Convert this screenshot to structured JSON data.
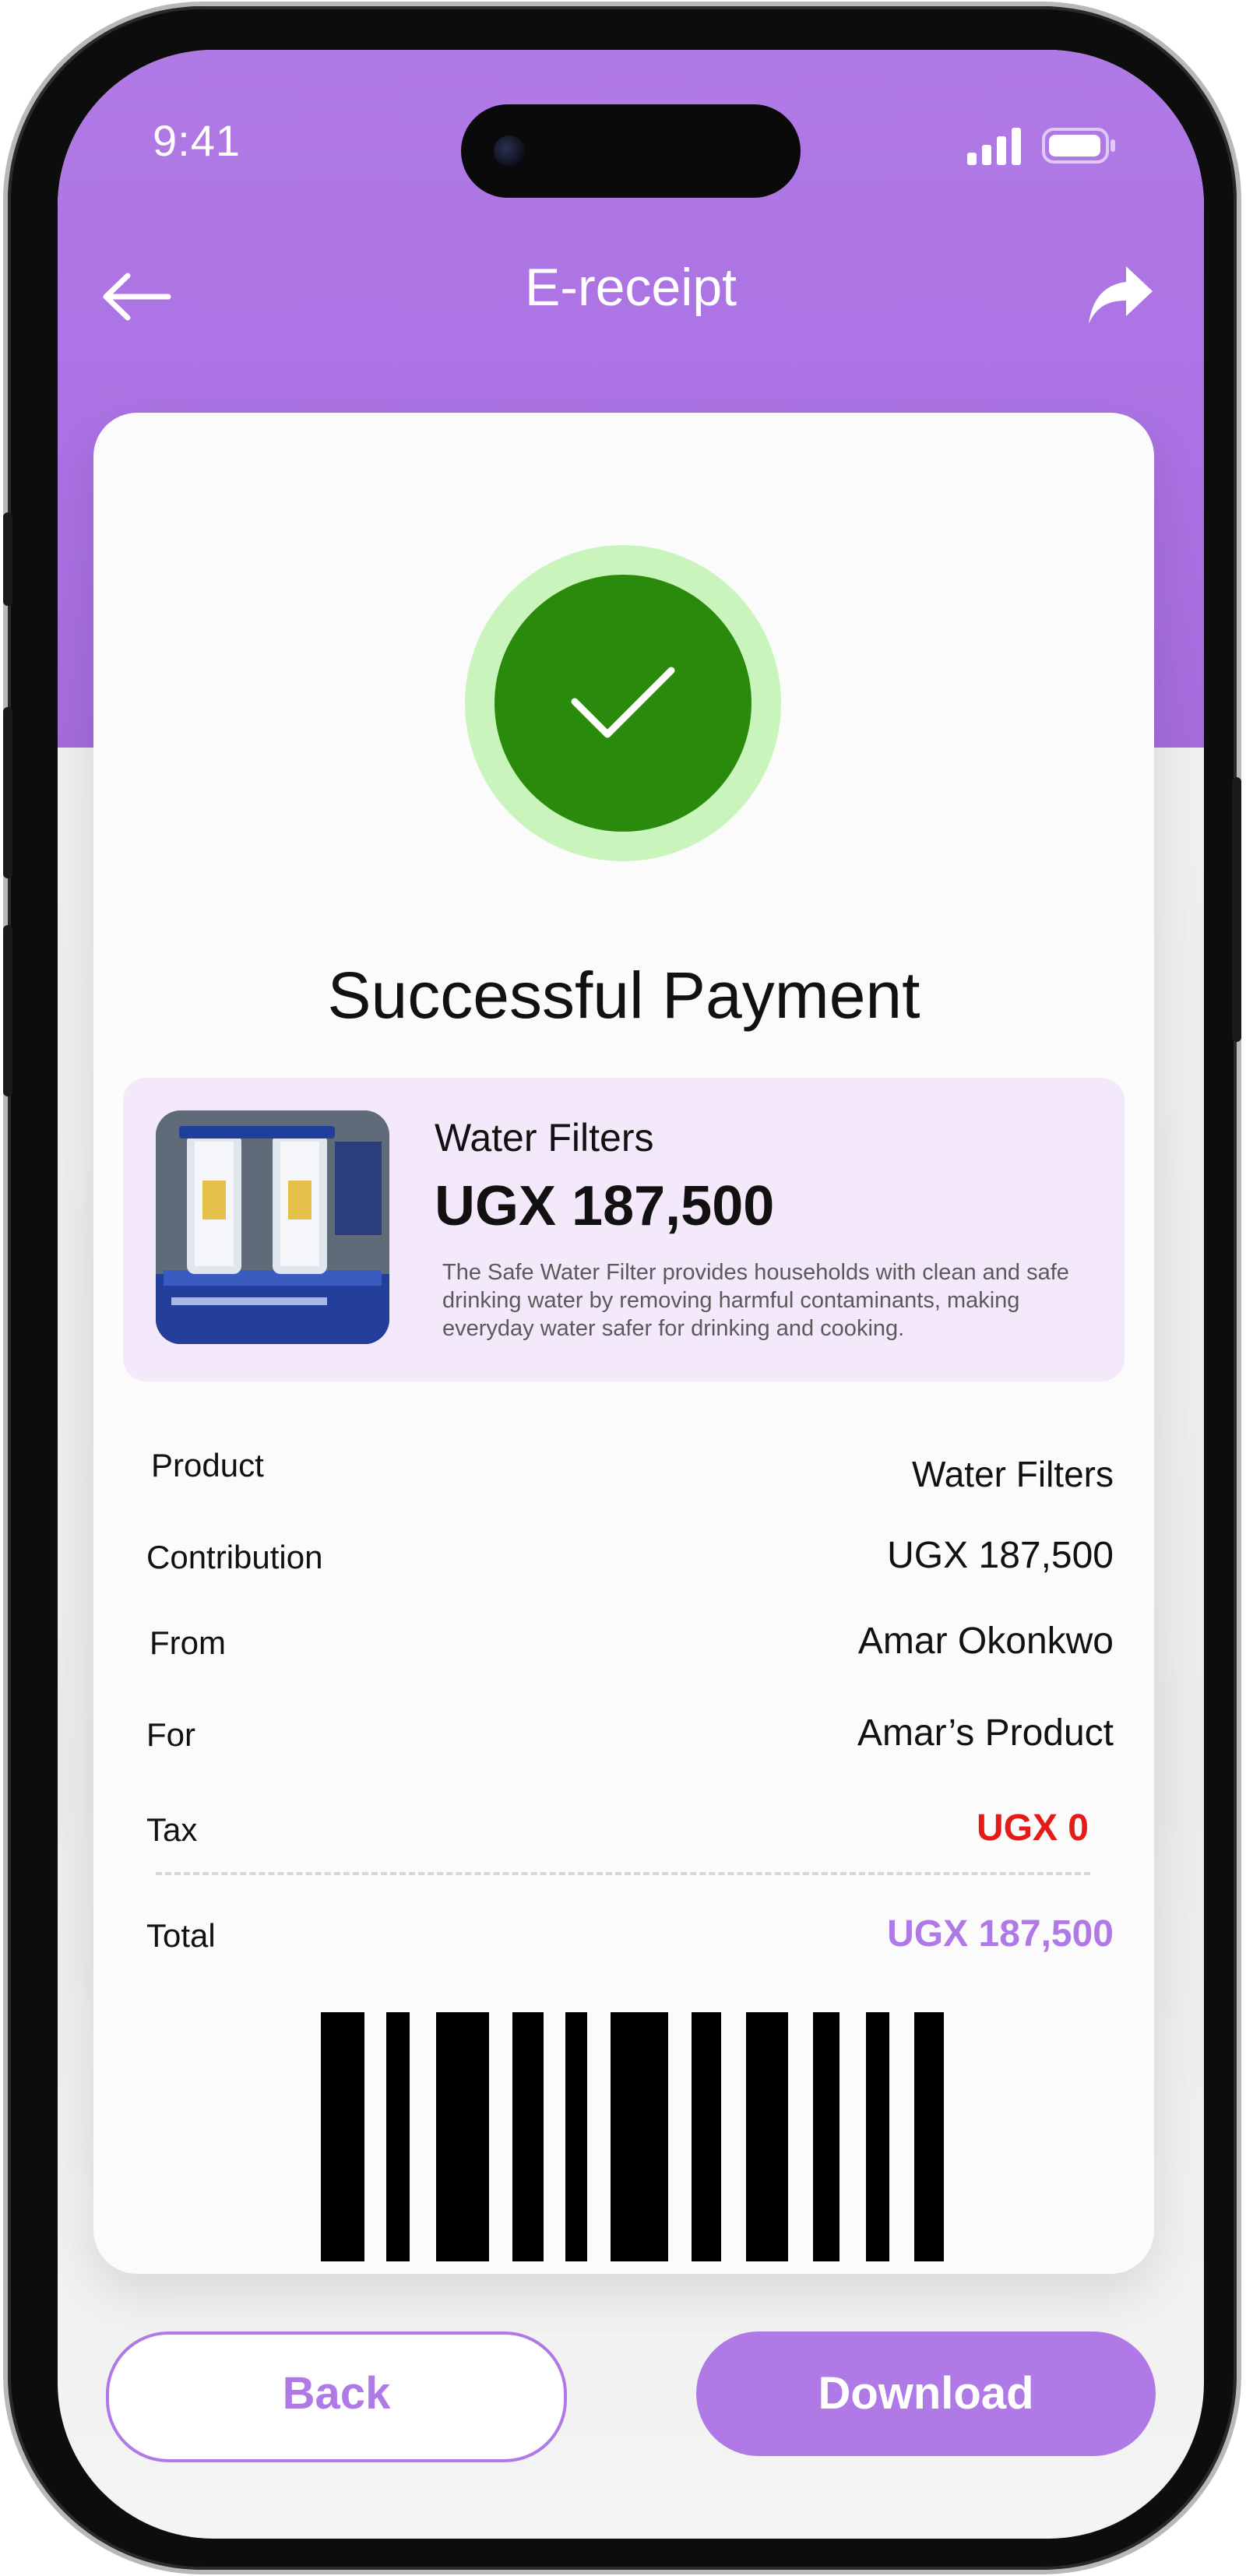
{
  "status_bar": {
    "time": "9:41"
  },
  "header": {
    "title": "E-receipt",
    "back_icon": "arrow-left-icon",
    "share_icon": "share-icon"
  },
  "success": {
    "title": "Successful Payment",
    "icon": "checkmark-icon"
  },
  "product": {
    "name": "Water Filters",
    "price": "UGX 187,500",
    "description": "The Safe Water Filter provides households with clean and safe drinking water by removing harmful contaminants, making everyday water safer for drinking and cooking."
  },
  "details": [
    {
      "label": "Product",
      "value": "Water Filters"
    },
    {
      "label": "Contribution",
      "value": "UGX 187,500"
    },
    {
      "label": "From",
      "value": "Amar Okonkwo"
    },
    {
      "label": "For",
      "value": "Amar’s Product"
    },
    {
      "label": "Tax",
      "value": "UGX 0"
    }
  ],
  "total": {
    "label": "Total",
    "value": "UGX 187,500"
  },
  "buttons": {
    "back": "Back",
    "download": "Download"
  },
  "colors": {
    "accent": "#b07ae6",
    "success_green": "#2a8a0c",
    "success_ring": "#c9f5bd",
    "tax_red": "#e41b17",
    "total_purple": "#b07ae6"
  }
}
